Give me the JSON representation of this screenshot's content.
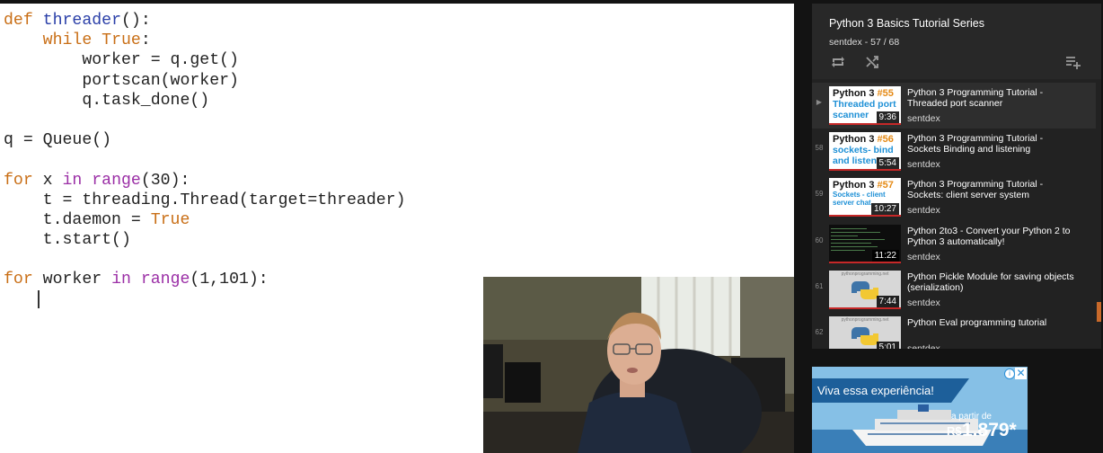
{
  "code_lines": [
    {
      "tokens": [
        {
          "t": "def ",
          "c": "kw"
        },
        {
          "t": "threader",
          "c": "fn"
        },
        {
          "t": "():",
          "c": ""
        }
      ]
    },
    {
      "tokens": [
        {
          "t": "    ",
          "c": ""
        },
        {
          "t": "while ",
          "c": "kw"
        },
        {
          "t": "True",
          "c": "kw"
        },
        {
          "t": ":",
          "c": ""
        }
      ]
    },
    {
      "tokens": [
        {
          "t": "        worker = q.get()",
          "c": ""
        }
      ]
    },
    {
      "tokens": [
        {
          "t": "        portscan(worker)",
          "c": ""
        }
      ]
    },
    {
      "tokens": [
        {
          "t": "        q.task_done()",
          "c": ""
        }
      ]
    },
    {
      "tokens": []
    },
    {
      "tokens": [
        {
          "t": "q = Queue()",
          "c": ""
        }
      ]
    },
    {
      "tokens": []
    },
    {
      "tokens": [
        {
          "t": "for ",
          "c": "kw"
        },
        {
          "t": "x ",
          "c": ""
        },
        {
          "t": "in ",
          "c": "bi"
        },
        {
          "t": "range",
          "c": "bi"
        },
        {
          "t": "(30):",
          "c": ""
        }
      ]
    },
    {
      "tokens": [
        {
          "t": "    t = threading.Thread(target=threader)",
          "c": ""
        }
      ]
    },
    {
      "tokens": [
        {
          "t": "    t.daemon = ",
          "c": ""
        },
        {
          "t": "True",
          "c": "kw"
        }
      ]
    },
    {
      "tokens": [
        {
          "t": "    t.start()",
          "c": ""
        }
      ]
    },
    {
      "tokens": []
    },
    {
      "tokens": [
        {
          "t": "for ",
          "c": "kw"
        },
        {
          "t": "worker ",
          "c": ""
        },
        {
          "t": "in ",
          "c": "bi"
        },
        {
          "t": "range",
          "c": "bi"
        },
        {
          "t": "(1,101):",
          "c": ""
        }
      ]
    },
    {
      "tokens": [
        {
          "t": "    ",
          "c": ""
        }
      ],
      "caret": true
    }
  ],
  "playlist": {
    "title": "Python 3 Basics Tutorial Series",
    "subtitle": "sentdex - 57 / 68",
    "items": [
      {
        "index": "▶",
        "title": "Python 3 Programming Tutorial - Threaded port scanner",
        "author": "sentdex",
        "duration": "9:36",
        "thumb": {
          "num": "#55",
          "line1": "Threaded port",
          "line2": "scanner"
        }
      },
      {
        "index": "58",
        "title": "Python 3 Programming Tutorial - Sockets Binding and listening",
        "author": "sentdex",
        "duration": "5:54",
        "thumb": {
          "num": "#56",
          "line1": "sockets- bind",
          "line2": "and listen"
        }
      },
      {
        "index": "59",
        "title": "Python 3 Programming Tutorial - Sockets: client server system",
        "author": "sentdex",
        "duration": "10:27",
        "thumb": {
          "num": "#57",
          "line1": "Sockets - client",
          "line2": "server chat"
        }
      },
      {
        "index": "60",
        "title": "Python 2to3 - Convert your Python 2 to Python 3 automatically!",
        "author": "sentdex",
        "duration": "11:22",
        "thumb": {
          "kind": "terminal"
        }
      },
      {
        "index": "61",
        "title": "Python Pickle Module for saving objects (serialization)",
        "author": "sentdex",
        "duration": "7:44",
        "thumb": {
          "kind": "logo",
          "caption": "pythonprogramming.net"
        }
      },
      {
        "index": "62",
        "title": "Python Eval programming tutorial",
        "author": "sentdex",
        "duration": "5:01",
        "thumb": {
          "kind": "logo",
          "caption": "pythonprogramming.net"
        }
      }
    ]
  },
  "ad": {
    "headline": "Viva essa experiência!",
    "from_label": "a partir de",
    "currency": "R$",
    "price": "1.879*",
    "info_icon": "info-icon",
    "close_icon": "close-icon"
  },
  "colors": {
    "accent": "#c8692a",
    "keyword": "#c96f17",
    "builtin": "#9b2fa6",
    "function": "#2a3fa8"
  }
}
